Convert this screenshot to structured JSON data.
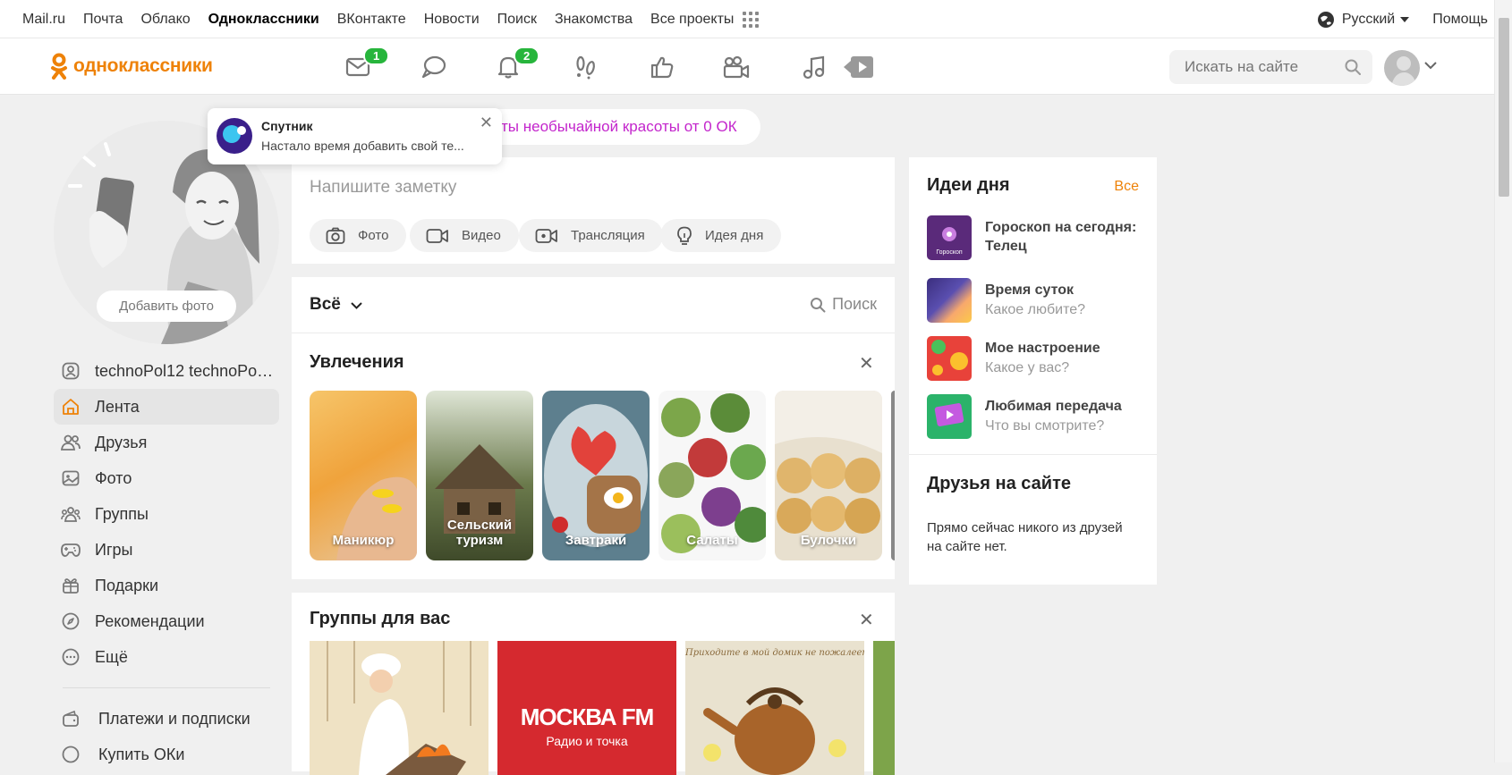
{
  "topbar": {
    "links": [
      "Mail.ru",
      "Почта",
      "Облако",
      "Одноклассники",
      "ВКонтакте",
      "Новости",
      "Поиск",
      "Знакомства",
      "Все проекты"
    ],
    "active_link": "Одноклассники",
    "language": "Русский",
    "help": "Помощь"
  },
  "header": {
    "logo_text": "одноклассники",
    "messages_badge": "1",
    "notifications_badge": "2",
    "search_placeholder": "Искать на сайте",
    "nav_icons": [
      "envelope-icon",
      "chat-icon",
      "bell-icon",
      "guests-footprints-icon",
      "like-icon",
      "video-camera-icon",
      "music-note-icon",
      "video-play-icon"
    ]
  },
  "tooltip": {
    "title": "Спутник",
    "text": "Настало время добавить свой те..."
  },
  "promo": {
    "text": "ты необычайной красоты от 0 ОК"
  },
  "profile": {
    "add_photo": "Добавить фото"
  },
  "sidebar": {
    "items": [
      {
        "label": "technoPol12 technoPol...",
        "icon": "user-icon"
      },
      {
        "label": "Лента",
        "icon": "home-icon",
        "active": true
      },
      {
        "label": "Друзья",
        "icon": "friends-icon"
      },
      {
        "label": "Фото",
        "icon": "photo-icon"
      },
      {
        "label": "Группы",
        "icon": "groups-icon"
      },
      {
        "label": "Игры",
        "icon": "gamepad-icon"
      },
      {
        "label": "Подарки",
        "icon": "gift-icon"
      },
      {
        "label": "Рекомендации",
        "icon": "compass-icon"
      },
      {
        "label": "Ещё",
        "icon": "more-icon"
      }
    ],
    "extra_items": [
      {
        "label": "Платежи и подписки",
        "icon": "wallet-icon"
      },
      {
        "label": "Купить ОКи",
        "icon": "ok-coin-icon"
      }
    ]
  },
  "note": {
    "placeholder": "Напишите заметку",
    "actions": [
      "Фото",
      "Видео",
      "Трансляция",
      "Идея дня"
    ]
  },
  "feed": {
    "filter": "Всё",
    "search": "Поиск",
    "hobbies_title": "Увлечения",
    "hobbies": [
      "Маникюр",
      "Сельский туризм",
      "Завтраки",
      "Салаты",
      "Булочки"
    ],
    "groups_title": "Группы для вас",
    "group_tiles": [
      "МОСКВА FM",
      "Радио и точка",
      "Приходите в мой домик не пожалеете!"
    ]
  },
  "ideas": {
    "title": "Идеи дня",
    "all": "Все",
    "items": [
      {
        "title": "Гороскоп на сегодня: Телец",
        "subtitle": "",
        "thumb_label": "Гороскоп"
      },
      {
        "title": "Время суток",
        "subtitle": "Какое любите?"
      },
      {
        "title": "Мое настроение",
        "subtitle": "Какое у вас?"
      },
      {
        "title": "Любимая передача",
        "subtitle": "Что вы смотрите?"
      }
    ],
    "friends_title": "Друзья на сайте",
    "friends_empty": "Прямо сейчас никого из друзей на сайте нет."
  },
  "colors": {
    "brand": "#ee8208",
    "badge": "#27b53c",
    "promo": "#c325cc"
  }
}
